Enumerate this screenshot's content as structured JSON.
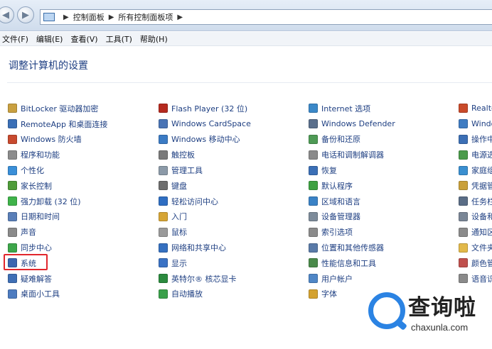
{
  "breadcrumb": [
    "控制面板",
    "所有控制面板项"
  ],
  "menu": [
    "文件(F)",
    "编辑(E)",
    "查看(V)",
    "工具(T)",
    "帮助(H)"
  ],
  "page_title": "调整计算机的设置",
  "columns": [
    [
      {
        "label": "BitLocker 驱动器加密",
        "icon": "bitlocker-icon",
        "color": "#c9a040"
      },
      {
        "label": "RemoteApp 和桌面连接",
        "icon": "remoteapp-icon",
        "color": "#3b6fb6"
      },
      {
        "label": "Windows 防火墙",
        "icon": "firewall-icon",
        "color": "#c84a2e"
      },
      {
        "label": "程序和功能",
        "icon": "programs-icon",
        "color": "#8c8c8c"
      },
      {
        "label": "个性化",
        "icon": "personalization-icon",
        "color": "#3a8fd8"
      },
      {
        "label": "家长控制",
        "icon": "parental-controls-icon",
        "color": "#4f9c3a"
      },
      {
        "label": "强力卸载 (32 位)",
        "icon": "uninstall-icon",
        "color": "#3fb34a"
      },
      {
        "label": "日期和时间",
        "icon": "clock-icon",
        "color": "#5a7fb8"
      },
      {
        "label": "声音",
        "icon": "sound-icon",
        "color": "#8a8a8a"
      },
      {
        "label": "同步中心",
        "icon": "sync-icon",
        "color": "#3da64a"
      },
      {
        "label": "系统",
        "icon": "system-icon",
        "color": "#3c66b0"
      },
      {
        "label": "疑难解答",
        "icon": "troubleshoot-icon",
        "color": "#3f6fb5"
      },
      {
        "label": "桌面小工具",
        "icon": "gadgets-icon",
        "color": "#4d7cc0"
      }
    ],
    [
      {
        "label": "Flash Player (32 位)",
        "icon": "flash-icon",
        "color": "#b52a1f"
      },
      {
        "label": "Windows CardSpace",
        "icon": "cardspace-icon",
        "color": "#4a74b5"
      },
      {
        "label": "Windows 移动中心",
        "icon": "mobility-icon",
        "color": "#3b7bc4"
      },
      {
        "label": "触控板",
        "icon": "touchpad-icon",
        "color": "#7a7a7a"
      },
      {
        "label": "管理工具",
        "icon": "admin-tools-icon",
        "color": "#8c9aa8"
      },
      {
        "label": "键盘",
        "icon": "keyboard-icon",
        "color": "#6d6d6d"
      },
      {
        "label": "轻松访问中心",
        "icon": "ease-of-access-icon",
        "color": "#2f6ec2"
      },
      {
        "label": "入门",
        "icon": "getting-started-icon",
        "color": "#d6a536"
      },
      {
        "label": "鼠标",
        "icon": "mouse-icon",
        "color": "#9a9a9a"
      },
      {
        "label": "网络和共享中心",
        "icon": "network-icon",
        "color": "#3570c0"
      },
      {
        "label": "显示",
        "icon": "display-icon",
        "color": "#3a72c4"
      },
      {
        "label": "英特尔® 核芯显卡",
        "icon": "intel-graphics-icon",
        "color": "#2b8a3e"
      },
      {
        "label": "自动播放",
        "icon": "autoplay-icon",
        "color": "#3aa04a"
      }
    ],
    [
      {
        "label": "Internet 选项",
        "icon": "internet-options-icon",
        "color": "#3b88c8"
      },
      {
        "label": "Windows Defender",
        "icon": "defender-icon",
        "color": "#5a6f8c"
      },
      {
        "label": "备份和还原",
        "icon": "backup-icon",
        "color": "#4e9a55"
      },
      {
        "label": "电话和调制解调器",
        "icon": "phone-modem-icon",
        "color": "#8a8a8a"
      },
      {
        "label": "恢复",
        "icon": "recovery-icon",
        "color": "#3b6fb6"
      },
      {
        "label": "默认程序",
        "icon": "default-programs-icon",
        "color": "#3ea142"
      },
      {
        "label": "区域和语言",
        "icon": "region-language-icon",
        "color": "#3a82c6"
      },
      {
        "label": "设备管理器",
        "icon": "device-manager-icon",
        "color": "#7d8b9a"
      },
      {
        "label": "索引选项",
        "icon": "indexing-icon",
        "color": "#8b8b8b"
      },
      {
        "label": "位置和其他传感器",
        "icon": "sensors-icon",
        "color": "#5a7aa8"
      },
      {
        "label": "性能信息和工具",
        "icon": "performance-icon",
        "color": "#4a8a4a"
      },
      {
        "label": "用户帐户",
        "icon": "user-accounts-icon",
        "color": "#4f86c6"
      },
      {
        "label": "字体",
        "icon": "fonts-icon",
        "color": "#d4a230"
      }
    ],
    [
      {
        "label": "Realte",
        "icon": "realtek-icon",
        "color": "#c94a2a"
      },
      {
        "label": "Windo",
        "icon": "windows-update-icon",
        "color": "#3f7cc2"
      },
      {
        "label": "操作中",
        "icon": "action-center-icon",
        "color": "#3c6fb5"
      },
      {
        "label": "电源选",
        "icon": "power-options-icon",
        "color": "#4a9a4a"
      },
      {
        "label": "家庭组",
        "icon": "homegroup-icon",
        "color": "#3a8fd0"
      },
      {
        "label": "凭据管",
        "icon": "credential-icon",
        "color": "#c9a03a"
      },
      {
        "label": "任务栏",
        "icon": "taskbar-icon",
        "color": "#5a6d86"
      },
      {
        "label": "设备和",
        "icon": "devices-printers-icon",
        "color": "#7a8696"
      },
      {
        "label": "通知区",
        "icon": "notification-area-icon",
        "color": "#8b8b8b"
      },
      {
        "label": "文件夹",
        "icon": "folder-options-icon",
        "color": "#e2b94a"
      },
      {
        "label": "颜色管",
        "icon": "color-management-icon",
        "color": "#c0504d"
      },
      {
        "label": "语音识",
        "icon": "speech-icon",
        "color": "#8a8a8a"
      }
    ]
  ],
  "watermark": {
    "text": "查询啦",
    "url": "chaxunla.com",
    "color": "#2b83e3"
  }
}
